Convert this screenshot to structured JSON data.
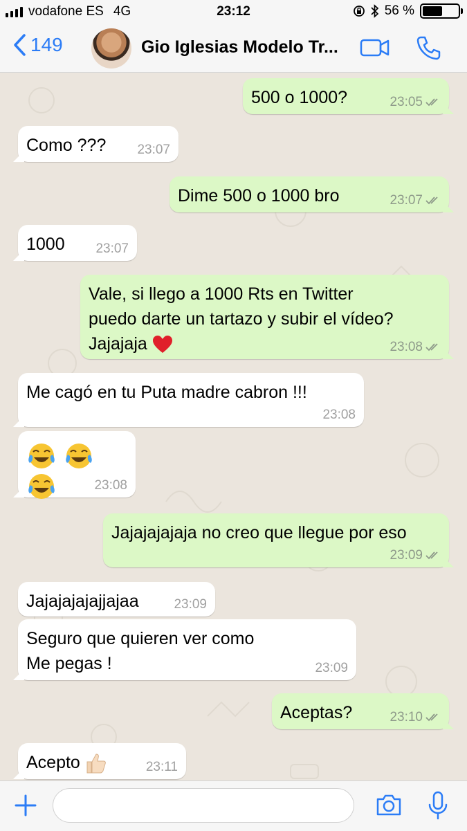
{
  "status_bar": {
    "carrier": "vodafone ES",
    "network": "4G",
    "time": "23:12",
    "battery_text": "56 %",
    "battery_level": 0.56
  },
  "header": {
    "back_count": "149",
    "contact_name": "Gio Iglesias Modelo Tr...",
    "accent_color": "#2b7cf6"
  },
  "messages": [
    {
      "dir": "out",
      "text": "500 o 1000?",
      "time": "23:05",
      "read": true
    },
    {
      "dir": "in",
      "text": "Como ???",
      "time": "23:07"
    },
    {
      "dir": "out",
      "text": "Dime 500 o 1000 bro",
      "time": "23:07",
      "read": true
    },
    {
      "dir": "in",
      "text": "1000",
      "time": "23:07"
    },
    {
      "dir": "out",
      "text": "Vale, si llego a 1000 Rts en Twitter\npuedo darte un tartazo y subir el vídeo?\nJajajaja",
      "emoji": "heart",
      "time": "23:08",
      "read": true
    },
    {
      "dir": "in",
      "text": "Me cagó en tu Puta madre cabron !!!",
      "time": "23:08"
    },
    {
      "dir": "in",
      "emoji": "laugh x3",
      "time": "23:08"
    },
    {
      "dir": "out",
      "text": "Jajajajajaja no creo que llegue por eso",
      "time": "23:09",
      "read": true
    },
    {
      "dir": "in",
      "text": "Jajajajajajjajaa",
      "time": "23:09"
    },
    {
      "dir": "in",
      "text": "Seguro que quieren ver como\nMe pegas !",
      "time": "23:09"
    },
    {
      "dir": "out",
      "text": "Aceptas?",
      "time": "23:10",
      "read": true
    },
    {
      "dir": "in",
      "text": "Acepto",
      "emoji": "thumbs-up",
      "time": "23:11"
    }
  ],
  "input": {
    "placeholder": ""
  },
  "colors": {
    "incoming_bubble": "#ffffff",
    "outgoing_bubble": "#dcf8c6",
    "chat_background": "#ebe5dd",
    "read_ticks": "#8e9a8a"
  }
}
